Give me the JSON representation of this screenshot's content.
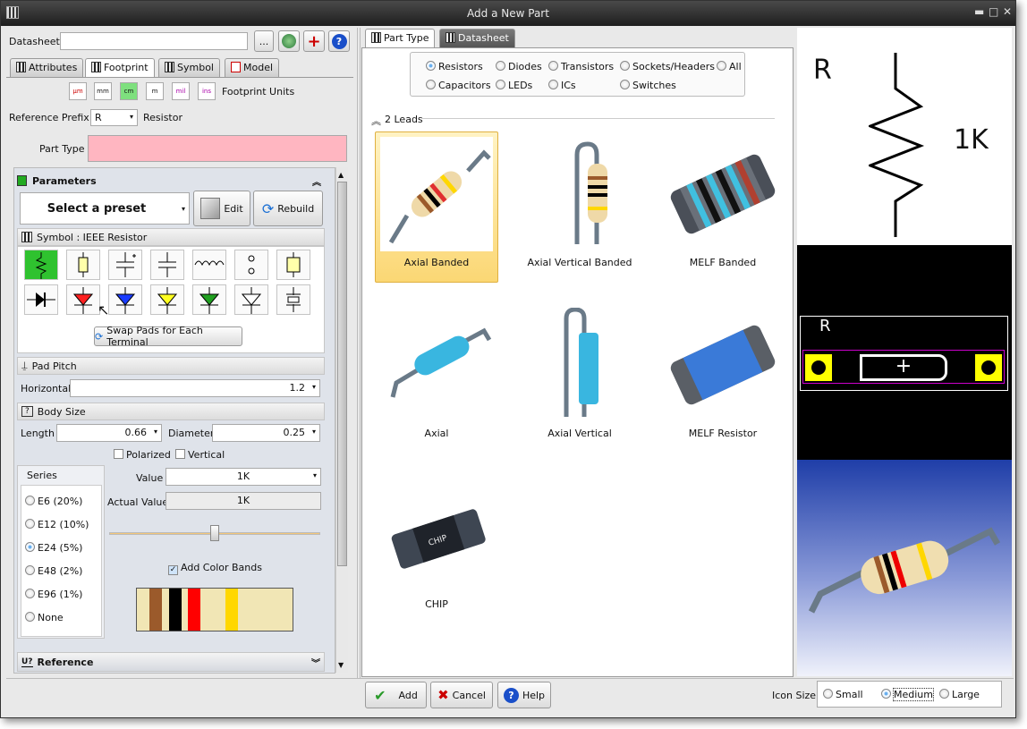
{
  "window": {
    "title": "Add a New Part",
    "min": "▬",
    "max": "□",
    "close": "✕"
  },
  "datasheet": {
    "label": "Datasheet",
    "value": "",
    "browse": "..."
  },
  "left_tabs": [
    "Attributes",
    "Footprint",
    "Symbol",
    "Model"
  ],
  "units": {
    "items": [
      "µm",
      "mm",
      "cm",
      "m",
      "mil",
      "ins"
    ],
    "label": "Footprint Units",
    "selected": "cm"
  },
  "refprefix": {
    "label": "Reference Prefix",
    "value": "R",
    "desc": "Resistor"
  },
  "parttype": {
    "label": "Part Type",
    "value": ""
  },
  "parameters": {
    "title": "Parameters",
    "preset": "Select a preset",
    "edit": "Edit",
    "rebuild": "Rebuild"
  },
  "symbol_section": {
    "title": "Symbol : IEEE Resistor",
    "swap": "Swap Pads for Each Terminal"
  },
  "pad_pitch": {
    "title": "Pad Pitch",
    "h_label": "Horizontal",
    "h_value": "1.2"
  },
  "body_size": {
    "title": "Body Size",
    "length_label": "Length",
    "length_value": "0.66",
    "diameter_label": "Diameter",
    "diameter_value": "0.25",
    "polarized": "Polarized",
    "vertical": "Vertical"
  },
  "series": {
    "title": "Series",
    "items": [
      "E6 (20%)",
      "E12 (10%)",
      "E24 (5%)",
      "E48 (2%)",
      "E96 (1%)",
      "None"
    ],
    "selected": "E24 (5%)"
  },
  "value": {
    "label": "Value",
    "value": "1K",
    "actual_label": "Actual Value",
    "actual_value": "1K",
    "add_bands": "Add Color Bands",
    "slider_fraction": 0.5
  },
  "reference": {
    "title": "Reference"
  },
  "right_tabs": [
    "Part Type",
    "Datasheet"
  ],
  "filters": {
    "row1": [
      "Resistors",
      "Diodes",
      "Transistors",
      "Sockets/Headers",
      "All"
    ],
    "row2": [
      "Capacitors",
      "LEDs",
      "ICs",
      "Switches"
    ],
    "selected": "Resistors"
  },
  "group": {
    "title": "2 Leads"
  },
  "parts": [
    "Axial Banded",
    "Axial Vertical Banded",
    "MELF Banded",
    "Axial",
    "Axial Vertical",
    "MELF Resistor",
    "CHIP"
  ],
  "preview": {
    "ref": "R",
    "value": "1K",
    "pcb_ref": "R"
  },
  "buttons": {
    "add": "Add",
    "cancel": "Cancel",
    "help": "Help"
  },
  "iconsize": {
    "label": "Icon Size",
    "options": [
      "Small",
      "Medium",
      "Large"
    ],
    "selected": "Medium"
  },
  "colors": {
    "selected_part": "#fde6a0",
    "parttype_field": "#ffb6c1",
    "pad": "#ffff00",
    "band_brown": "#9b5a2b",
    "band_black": "#000000",
    "band_red": "#ff0000",
    "band_gold": "#ffd700"
  }
}
